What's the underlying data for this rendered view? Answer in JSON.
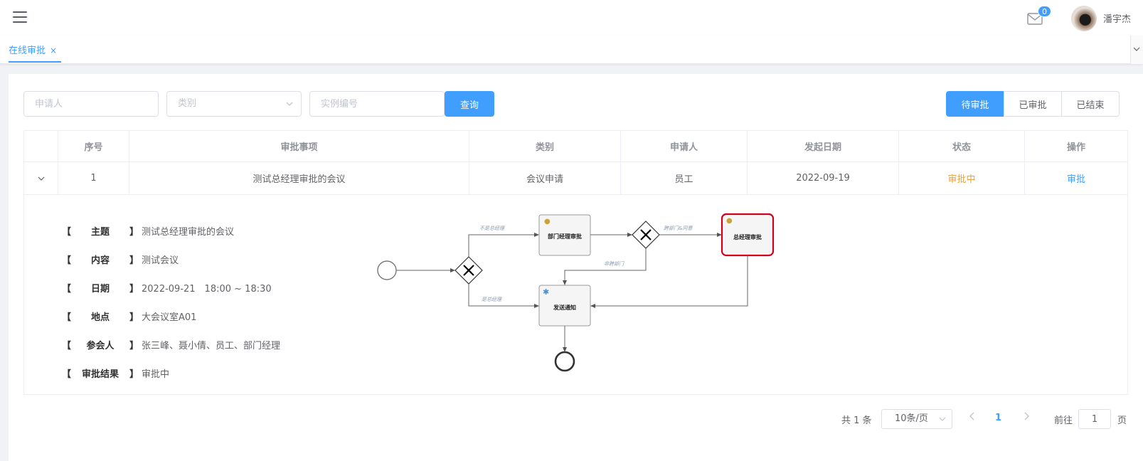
{
  "header": {
    "mail_count": "0",
    "username": "潘宇杰"
  },
  "tags": {
    "active_tag": "在线审批",
    "close_glyph": "×"
  },
  "filters": {
    "applicant_placeholder": "申请人",
    "category_placeholder": "类别",
    "instance_placeholder": "实例编号",
    "search_label": "查询"
  },
  "status_tabs": [
    "待审批",
    "已审批",
    "已结束"
  ],
  "table": {
    "headers": [
      "",
      "序号",
      "审批事项",
      "类别",
      "申请人",
      "发起日期",
      "状态",
      "操作"
    ],
    "row": {
      "index": "1",
      "item": "测试总经理审批的会议",
      "category": "会议申请",
      "applicant": "员工",
      "date": "2022-09-19",
      "status": "审批中",
      "action": "审批"
    }
  },
  "detail": {
    "bracket_open": "【",
    "bracket_close": "】",
    "rows": [
      {
        "label": "主题",
        "value": "测试总经理审批的会议"
      },
      {
        "label": "内容",
        "value": "测试会议"
      },
      {
        "label": "日期",
        "value": "2022-09-21　18:00 ~ 18:30"
      },
      {
        "label": "地点",
        "value": "大会议室A01"
      },
      {
        "label": "参会人",
        "value": "张三峰、聂小倩、员工、部门经理"
      },
      {
        "label": "审批结果",
        "value": "审批中"
      }
    ]
  },
  "flow": {
    "task_dept": "部门经理审批",
    "task_gm": "总经理审批",
    "task_notify": "发送通知",
    "edge_not_gm": "不是总经理",
    "edge_is_gm": "是总经理",
    "edge_cross_dept": "跨部门&同意",
    "edge_not_cross": "非跨部门",
    "highlight_color": "#d0021b"
  },
  "pagination": {
    "total": "共 1 条",
    "page_size": "10条/页",
    "current": "1",
    "goto": "前往",
    "jump_value": "1",
    "page_unit": "页"
  },
  "colors": {
    "primary": "#409eff",
    "warning": "#e6a23c"
  }
}
